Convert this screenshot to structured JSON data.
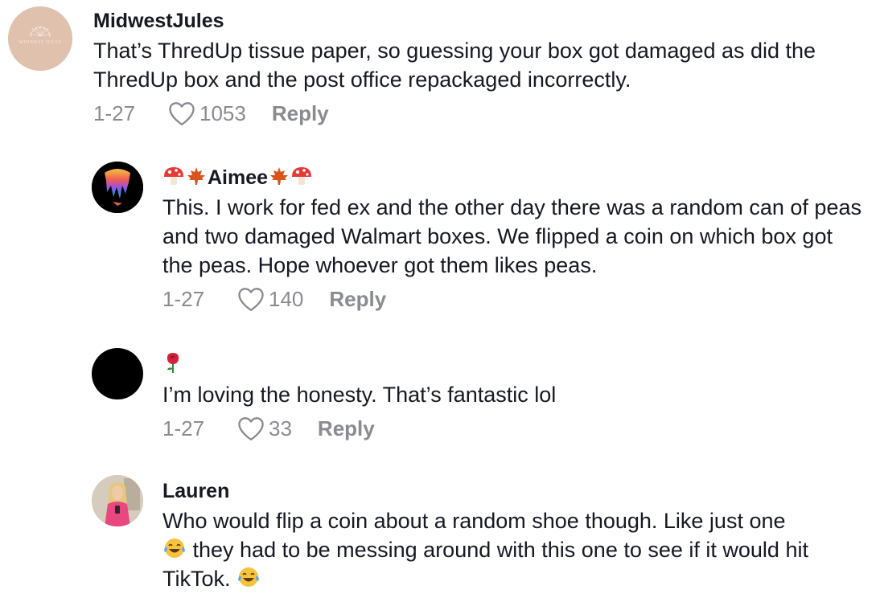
{
  "comments": [
    {
      "username": "MidwestJules",
      "text": "That’s ThredUp tissue paper, so guessing your box got damaged as did the ThredUp box and the post office repackaged incorrectly.",
      "date": "1-27",
      "likes": "1053",
      "reply_label": "Reply",
      "avatar_text": "MIDWEST JULES"
    },
    {
      "username_prefix_emojis": [
        "mushroom",
        "maple-leaf"
      ],
      "username": "Aimee",
      "username_suffix_emojis": [
        "maple-leaf",
        "mushroom"
      ],
      "text": "This. I work for fed ex and the other day there was a random can of peas and two damaged Walmart boxes. We flipped a coin on which box got the peas. Hope whoever got them likes peas.",
      "date": "1-27",
      "likes": "140",
      "reply_label": "Reply"
    },
    {
      "username_emoji": "rose",
      "text": "I’m loving the honesty. That’s fantastic lol",
      "date": "1-27",
      "likes": "33",
      "reply_label": "Reply"
    },
    {
      "username": "Lauren",
      "text_part1": "Who would flip a coin about a random shoe though. Like just one",
      "text_part2": " they had to be messing around with this one to see if it would hit TikTok. ",
      "inline_emoji": "face-with-tears-of-joy"
    }
  ],
  "colors": {
    "text": "#161823",
    "meta": "#8a8b91",
    "avatar1_bg": "#dfc1ae",
    "avatar3_bg": "#000000"
  }
}
